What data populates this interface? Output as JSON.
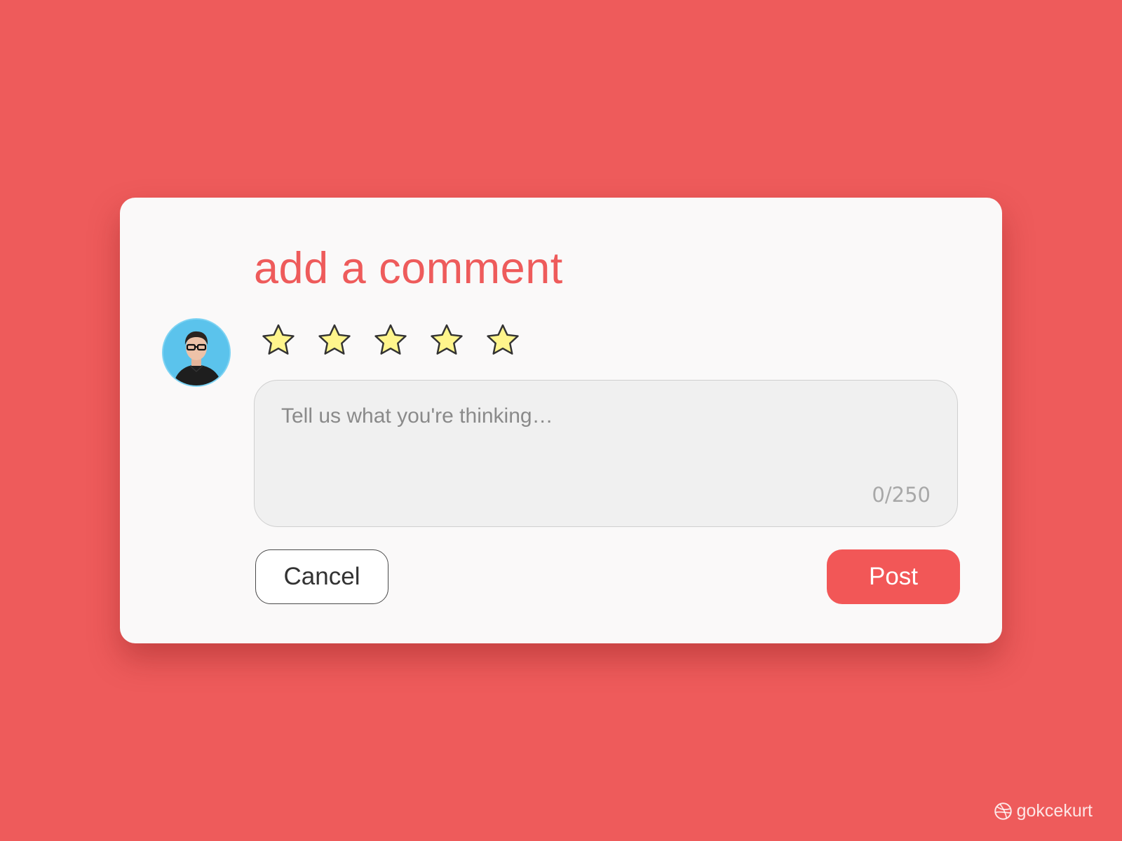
{
  "comment_form": {
    "title": "add a comment",
    "rating": {
      "max_stars": 5,
      "star_fill_color": "#FFF58C",
      "star_outline_color": "#333333",
      "star_icon": "star-icon"
    },
    "input": {
      "placeholder": "Tell us what you're thinking…",
      "value": "",
      "char_count": "0/250"
    },
    "buttons": {
      "cancel_label": "Cancel",
      "post_label": "Post"
    },
    "colors": {
      "accent": "#EE5B5B",
      "post_button": "#F25757",
      "card_background": "#FAF9F9",
      "avatar_background": "#5BC3EC"
    }
  },
  "watermark": {
    "icon": "dribbble-icon",
    "text": "gokcekurt"
  }
}
